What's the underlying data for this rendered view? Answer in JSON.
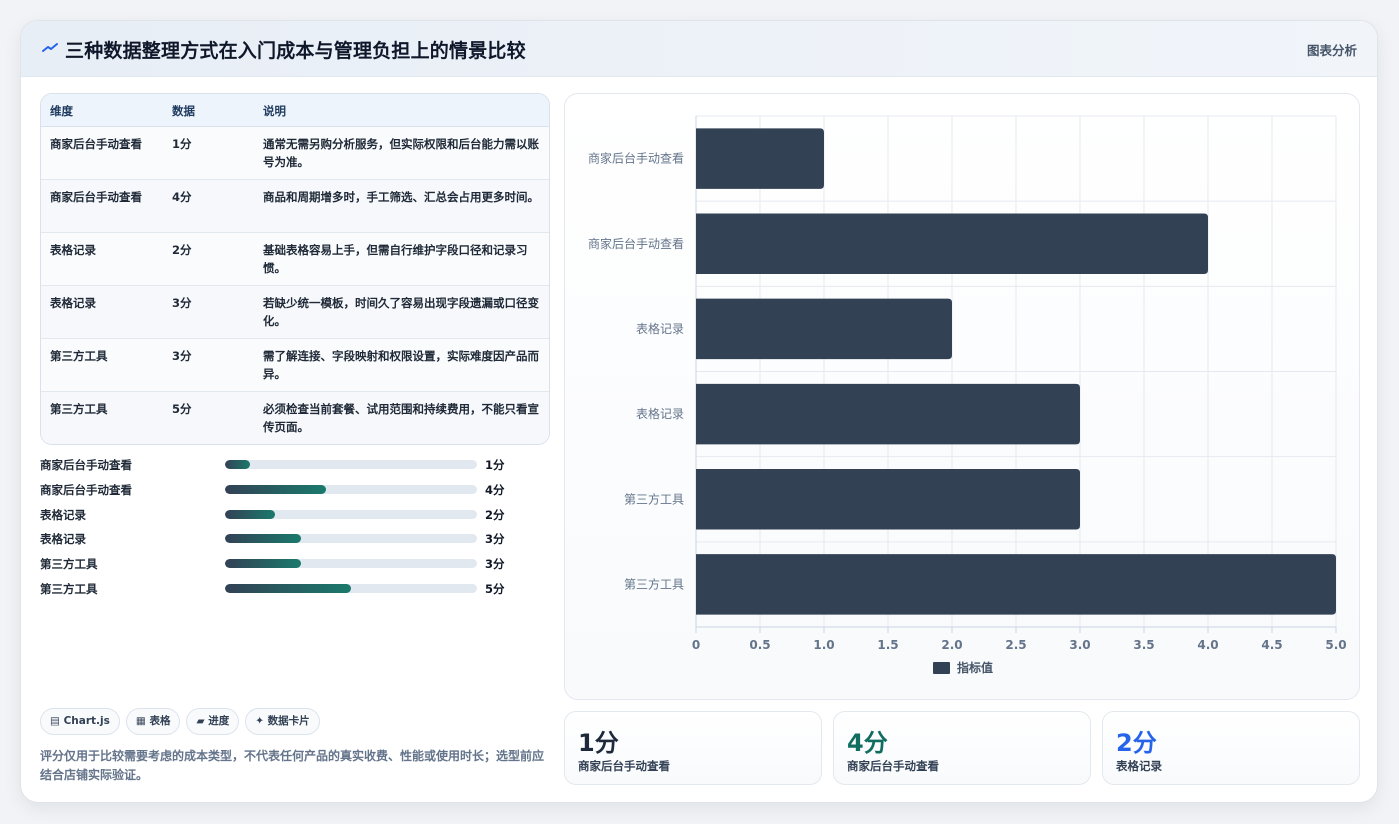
{
  "header": {
    "title": "三种数据整理方式在入门成本与管理负担上的情景比较",
    "tag": "图表分析",
    "icon": "trend-icon"
  },
  "table": {
    "headers": [
      "维度",
      "数据",
      "说明"
    ],
    "rows": [
      {
        "dim": "商家后台手动查看",
        "val": "1分",
        "desc": "通常无需另购分析服务，但实际权限和后台能力需以账号为准。"
      },
      {
        "dim": "商家后台手动查看",
        "val": "4分",
        "desc": "商品和周期增多时，手工筛选、汇总会占用更多时间。"
      },
      {
        "dim": "表格记录",
        "val": "2分",
        "desc": "基础表格容易上手，但需自行维护字段口径和记录习惯。"
      },
      {
        "dim": "表格记录",
        "val": "3分",
        "desc": "若缺少统一模板，时间久了容易出现字段遗漏或口径变化。"
      },
      {
        "dim": "第三方工具",
        "val": "3分",
        "desc": "需了解连接、字段映射和权限设置，实际难度因产品而异。"
      },
      {
        "dim": "第三方工具",
        "val": "5分",
        "desc": "必须检查当前套餐、试用范围和持续费用，不能只看宣传页面。"
      }
    ]
  },
  "progress": [
    {
      "label": "商家后台手动查看",
      "value": 1,
      "text": "1分"
    },
    {
      "label": "商家后台手动查看",
      "value": 4,
      "text": "4分"
    },
    {
      "label": "表格记录",
      "value": 2,
      "text": "2分"
    },
    {
      "label": "表格记录",
      "value": 3,
      "text": "3分"
    },
    {
      "label": "第三方工具",
      "value": 3,
      "text": "3分"
    },
    {
      "label": "第三方工具",
      "value": 5,
      "text": "5分"
    }
  ],
  "progress_max": 10,
  "chips": [
    {
      "icon": "chart-icon",
      "glyph": "▤",
      "label": "Chart.js"
    },
    {
      "icon": "table-icon",
      "glyph": "▦",
      "label": "表格"
    },
    {
      "icon": "progress-icon",
      "glyph": "▰",
      "label": "进度"
    },
    {
      "icon": "card-icon",
      "glyph": "✦",
      "label": "数据卡片"
    }
  ],
  "note": "评分仅用于比较需要考虑的成本类型，不代表任何产品的真实收费、性能或使用时长；选型前应结合店铺实际验证。",
  "stats": [
    {
      "value": "1分",
      "label": "商家后台手动查看",
      "color": "#1e293b"
    },
    {
      "value": "4分",
      "label": "商家后台手动查看",
      "color": "#0f6e5f"
    },
    {
      "value": "2分",
      "label": "表格记录",
      "color": "#2563eb"
    }
  ],
  "chart_data": {
    "type": "bar",
    "orientation": "horizontal",
    "categories": [
      "商家后台手动查看",
      "商家后台手动查看",
      "表格记录",
      "表格记录",
      "第三方工具",
      "第三方工具"
    ],
    "series": [
      {
        "name": "指标值",
        "values": [
          1,
          4,
          2,
          3,
          3,
          5
        ]
      }
    ],
    "xlim": [
      0,
      5
    ],
    "xticks": [
      "0",
      "0.5",
      "1.0",
      "1.5",
      "2.0",
      "2.5",
      "3.0",
      "3.5",
      "4.0",
      "4.5",
      "5.0"
    ],
    "grid": true,
    "legend": "bottom",
    "bar_color": "#334155"
  }
}
